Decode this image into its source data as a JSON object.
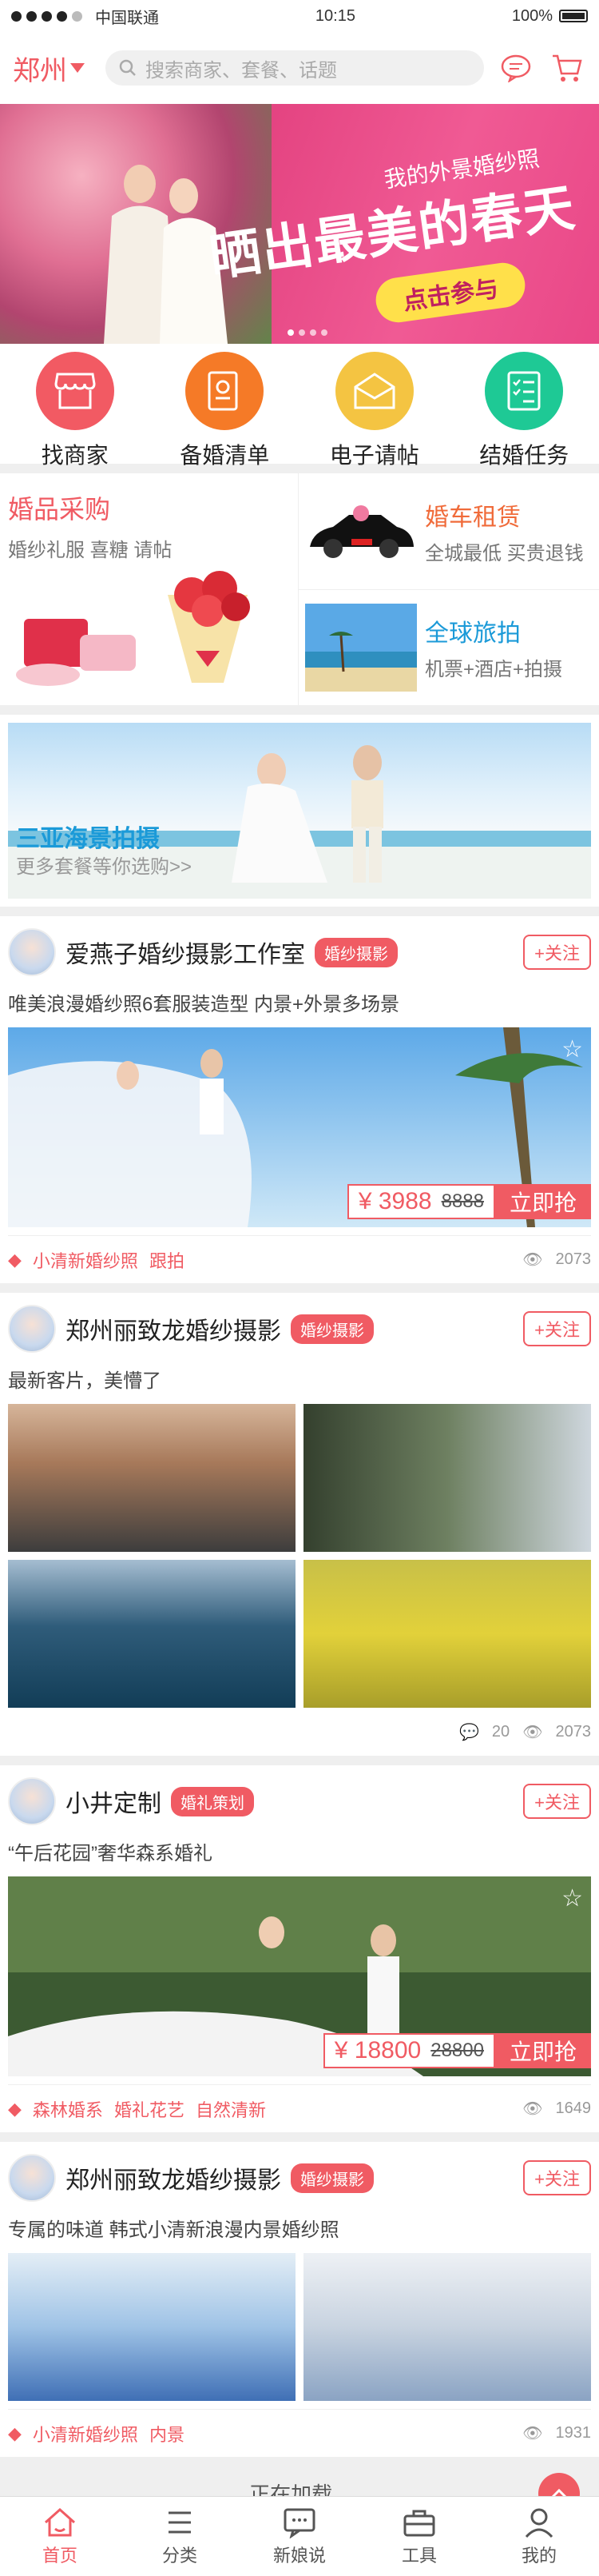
{
  "status": {
    "carrier": "中国联通",
    "time": "10:15",
    "battery": "100%"
  },
  "header": {
    "city": "郑州",
    "search_placeholder": "搜索商家、套餐、话题"
  },
  "banner": {
    "sub": "我的外景婚纱照",
    "main": "晒出最美的春天",
    "cta": "点击参与",
    "dots": 4,
    "active_dot": 0
  },
  "categories": [
    {
      "label": "找商家",
      "color": "#f25a63",
      "icon": "shop-icon"
    },
    {
      "label": "备婚清单",
      "color": "#f57a27",
      "icon": "checklist-doc-icon"
    },
    {
      "label": "电子请帖",
      "color": "#f4c442",
      "icon": "invitation-icon"
    },
    {
      "label": "结婚任务",
      "color": "#1ec995",
      "icon": "task-list-icon"
    }
  ],
  "promo": {
    "left": {
      "title": "婚品采购",
      "sub": "婚纱礼服 喜糖 请帖"
    },
    "car": {
      "title": "婚车租赁",
      "sub": "全城最低 买贵退钱"
    },
    "travel": {
      "title": "全球旅拍",
      "sub": "机票+酒店+拍摄"
    }
  },
  "ad": {
    "title": "三亚海景拍摄",
    "sub": "更多套餐等你选购>>"
  },
  "posts": [
    {
      "name": "爱燕子婚纱摄影工作室",
      "tag": "婚纱摄影",
      "follow": "+关注",
      "desc": "唯美浪漫婚纱照6套服装造型 内景+外景多场景",
      "price": "¥ 3988",
      "orig": "8888",
      "buy": "立即抢",
      "tags": [
        "小清新婚纱照",
        "跟拍"
      ],
      "views": "2073"
    },
    {
      "name": "郑州丽致龙婚纱摄影",
      "tag": "婚纱摄影",
      "follow": "+关注",
      "desc": "最新客片，美懵了",
      "comments": "20",
      "views": "2073"
    },
    {
      "name": "小井定制",
      "tag": "婚礼策划",
      "follow": "+关注",
      "desc": "“午后花园”奢华森系婚礼",
      "price": "¥ 18800",
      "orig": "28800",
      "buy": "立即抢",
      "tags": [
        "森林婚系",
        "婚礼花艺",
        "自然清新"
      ],
      "views": "1649"
    },
    {
      "name": "郑州丽致龙婚纱摄影",
      "tag": "婚纱摄影",
      "follow": "+关注",
      "desc": "专属的味道 韩式小清新浪漫内景婚纱照",
      "tags": [
        "小清新婚纱照",
        "内景"
      ],
      "views": "1931"
    }
  ],
  "loading": "正在加载...",
  "tabbar": [
    {
      "label": "首页",
      "icon": "home-icon",
      "active": true
    },
    {
      "label": "分类",
      "icon": "list-icon",
      "active": false
    },
    {
      "label": "新娘说",
      "icon": "chat-icon",
      "active": false
    },
    {
      "label": "工具",
      "icon": "toolbox-icon",
      "active": false
    },
    {
      "label": "我的",
      "icon": "user-icon",
      "active": false
    }
  ],
  "colors": {
    "accent": "#f05b63",
    "blue": "#1b9ad8",
    "orange": "#f06b3a"
  }
}
